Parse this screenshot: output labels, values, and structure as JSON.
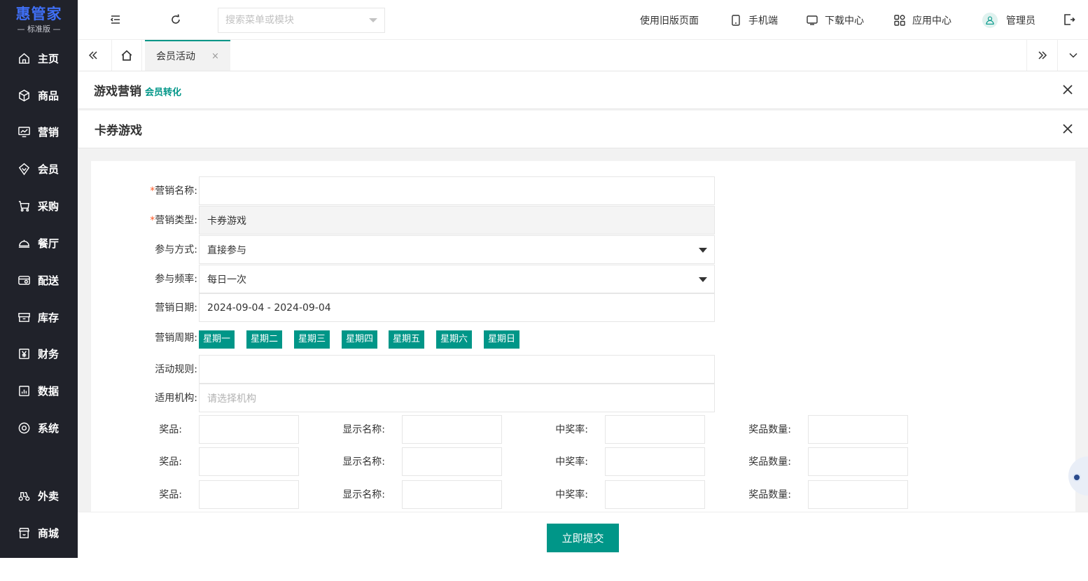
{
  "logo": {
    "name": "惠管家",
    "edition": "— 标准版 —"
  },
  "sidebar": {
    "items": [
      {
        "label": "主页",
        "icon": "home-icon"
      },
      {
        "label": "商品",
        "icon": "box-icon"
      },
      {
        "label": "营销",
        "icon": "monitor-chart-icon"
      },
      {
        "label": "会员",
        "icon": "diamond-icon"
      },
      {
        "label": "采购",
        "icon": "cart-icon"
      },
      {
        "label": "餐厅",
        "icon": "cloche-icon"
      },
      {
        "label": "配送",
        "icon": "delivery-icon"
      },
      {
        "label": "库存",
        "icon": "archive-icon"
      },
      {
        "label": "财务",
        "icon": "yen-icon"
      },
      {
        "label": "数据",
        "icon": "bar-chart-icon"
      },
      {
        "label": "系统",
        "icon": "settings-icon"
      },
      {
        "label": "外卖",
        "icon": "scooter-icon"
      },
      {
        "label": "商城",
        "icon": "shop-icon"
      }
    ]
  },
  "topbar": {
    "search_placeholder": "搜索菜单或模块",
    "old_page": "使用旧版页面",
    "mobile": "手机端",
    "download": "下载中心",
    "apps": "应用中心",
    "user": "管理员"
  },
  "tabs": [
    {
      "label": "会员活动",
      "close": "×"
    }
  ],
  "panels": {
    "outer": {
      "title": "游戏营销",
      "subtitle": "会员转化"
    },
    "inner": {
      "title": "卡券游戏"
    }
  },
  "form": {
    "name_label": "营销名称:",
    "name_value": "",
    "type_label": "营销类型:",
    "type_value": "卡券游戏",
    "mode_label": "参与方式:",
    "mode_value": "直接参与",
    "freq_label": "参与频率:",
    "freq_value": "每日一次",
    "date_label": "营销日期:",
    "date_value": "2024-09-04 - 2024-09-04",
    "cycle_label": "营销周期:",
    "weekdays": [
      "星期一",
      "星期二",
      "星期三",
      "星期四",
      "星期五",
      "星期六",
      "星期日"
    ],
    "rules_label": "活动规则:",
    "rules_value": "",
    "org_label": "适用机构:",
    "org_placeholder": "请选择机构",
    "prize_label": "奖品:",
    "display_label": "显示名称:",
    "rate_label": "中奖率:",
    "qty_label": "奖品数量:",
    "prize_rows": 3,
    "required_mark": "*"
  },
  "footer": {
    "submit": "立即提交"
  },
  "colors": {
    "accent": "#009688",
    "sidebar": "#20222a",
    "logo": "#3f6ff5"
  }
}
